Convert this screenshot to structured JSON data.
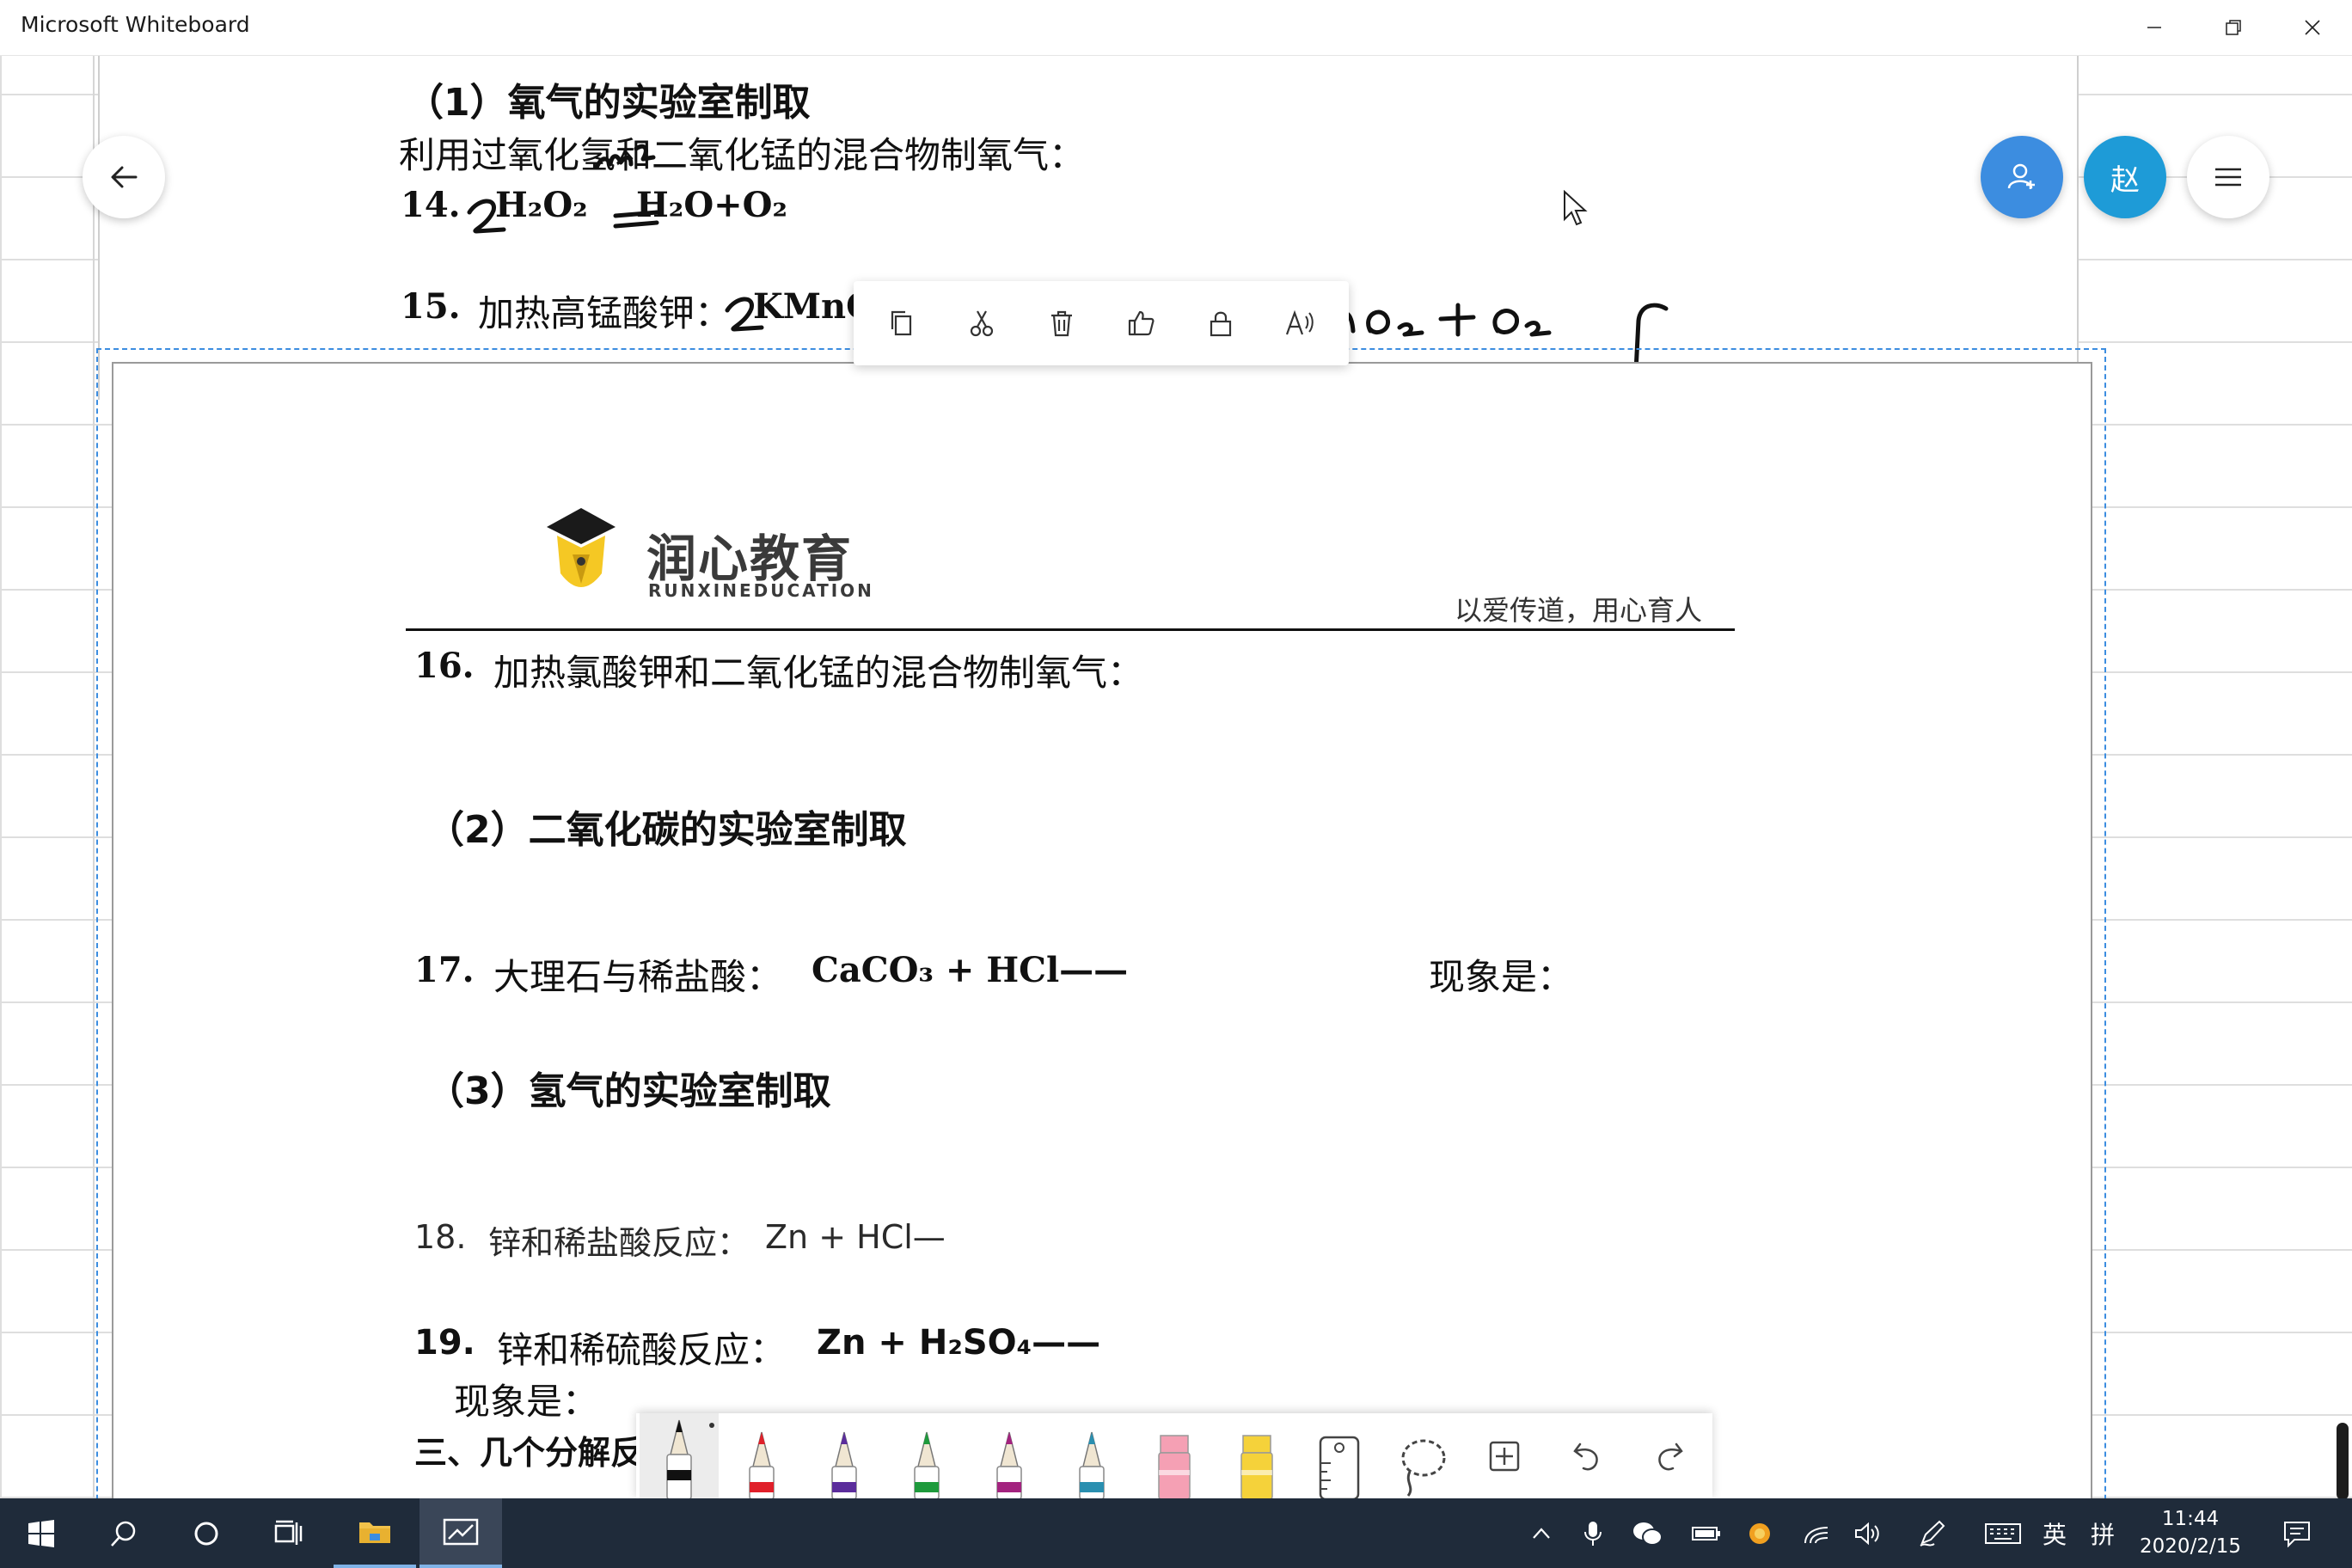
{
  "window": {
    "title": "Microsoft Whiteboard",
    "controls": [
      "minimize",
      "restore",
      "close"
    ]
  },
  "header": {
    "back_icon": "arrow-left-icon",
    "invite_icon": "person-add-icon",
    "avatar_initial": "赵",
    "menu_icon": "hamburger-menu-icon",
    "accent_color": "#3c8de0",
    "avatar_color": "#1e9bd7"
  },
  "context_toolbar": {
    "items": [
      "copy-icon",
      "cut-icon",
      "delete-icon",
      "like-icon",
      "lock-icon",
      "read-aloud-icon"
    ]
  },
  "doc_top": {
    "heading": "（1）氧气的实验室制取",
    "line1": "利用过氧化氢和二氧化锰的混合物制氧气：",
    "eq14_num": "14.",
    "eq14_left": "H₂O₂",
    "eq14_right": "H₂O+O₂",
    "eq15_num": "15.",
    "eq15_text": "加热高锰酸钾：",
    "eq15_formula": "KMnO₄"
  },
  "doc_main": {
    "logo_cn": "润心教育",
    "logo_en": "RUNXINEDUCATION",
    "motto": "以爱传道，用心育人",
    "q16_num": "16.",
    "q16_text": "加热氯酸钾和二氧化锰的混合物制氧气：",
    "sec2": "（2）二氧化碳的实验室制取",
    "q17_num": "17.",
    "q17_text": "大理石与稀盐酸：",
    "q17_formula": "CaCO₃ + HCl——",
    "q17_phen": "现象是：",
    "sec3": "（3）氢气的实验室制取",
    "q18_num": "18.",
    "q18_text": "锌和稀盐酸反应：",
    "q18_formula": "Zn + HCl—",
    "q19_num": "19.",
    "q19_text": "锌和稀硫酸反应：",
    "q19_formula": "Zn + H₂SO₄——",
    "q19_phen": "现象是：",
    "sec_next": "三、几个分解反应"
  },
  "pen_tray": {
    "tools": [
      {
        "name": "black-pen",
        "color": "#111111"
      },
      {
        "name": "red-pen",
        "color": "#e0202a"
      },
      {
        "name": "purple-pen",
        "color": "#5b2d9c"
      },
      {
        "name": "green-pen",
        "color": "#1e9a3c"
      },
      {
        "name": "magenta-pen",
        "color": "#a3237f"
      },
      {
        "name": "teal-pen",
        "color": "#2a8fb0"
      },
      {
        "name": "pink-highlighter",
        "color": "#f5a0b4"
      },
      {
        "name": "yellow-highlighter",
        "color": "#f5d23a"
      },
      {
        "name": "ruler-icon",
        "color": "#555555"
      },
      {
        "name": "lasso-icon",
        "color": "#555555"
      },
      {
        "name": "add-icon",
        "color": "#555555"
      },
      {
        "name": "undo-icon",
        "color": "#555555"
      },
      {
        "name": "redo-icon",
        "color": "#555555"
      }
    ]
  },
  "taskbar": {
    "time": "11:44",
    "date": "2020/2/15",
    "ime": "英",
    "ime2": "拼"
  }
}
